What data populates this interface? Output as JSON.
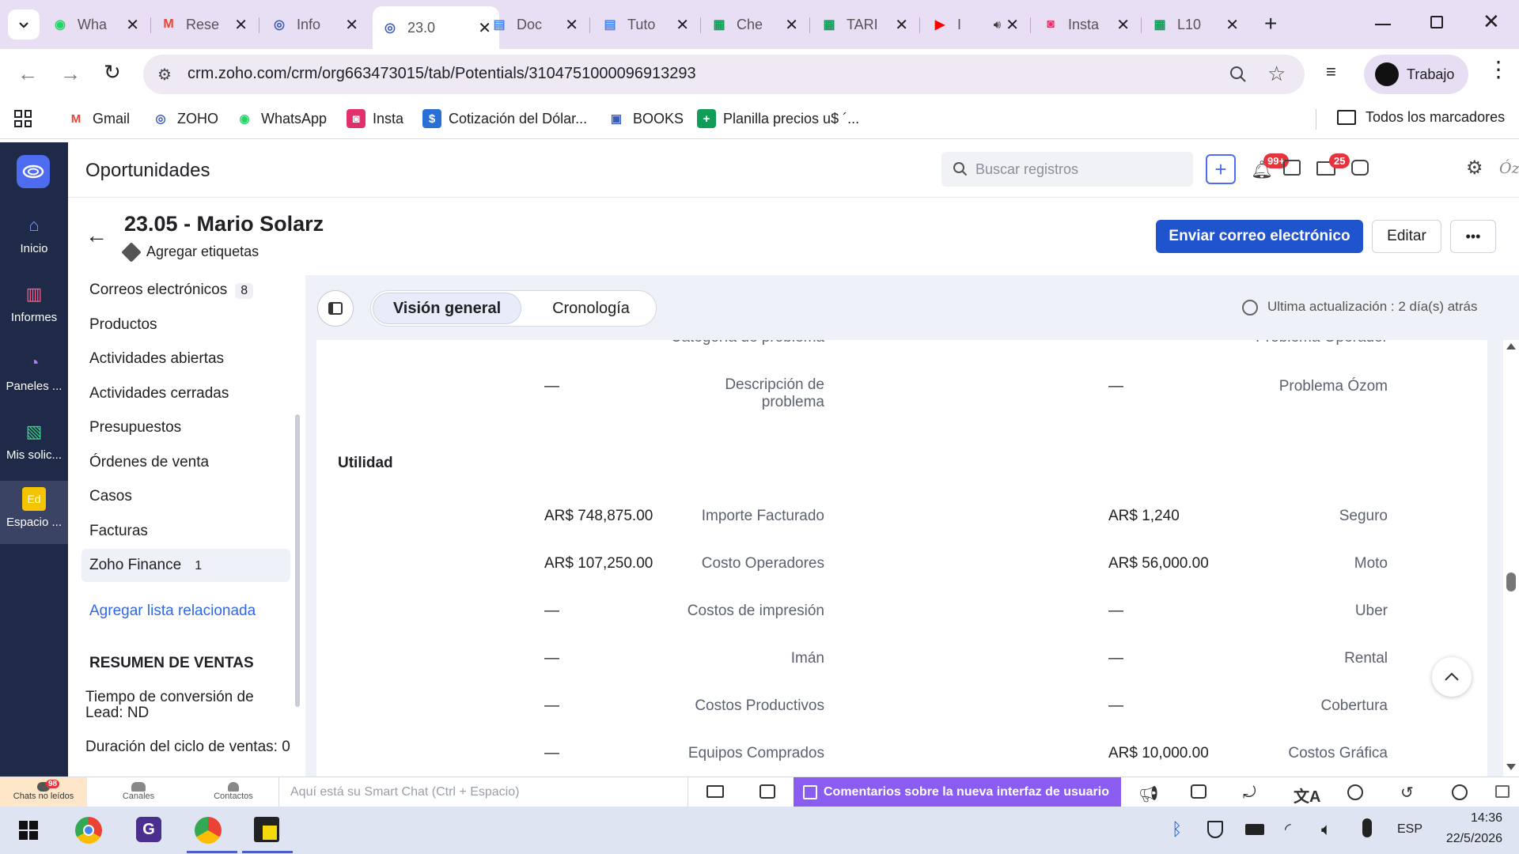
{
  "browser": {
    "tabs": [
      {
        "title": "Wha",
        "icon": "whatsapp-icon",
        "color": "#25d366"
      },
      {
        "title": "Rese",
        "icon": "gmail-icon",
        "color": "#ea4335"
      },
      {
        "title": "Info",
        "icon": "zoho-crm-icon",
        "color": "#3a5bb8"
      },
      {
        "title": "23.0",
        "icon": "zoho-crm-icon",
        "color": "#3a5bb8"
      },
      {
        "title": "Doc",
        "icon": "docs-icon",
        "color": "#4285f4"
      },
      {
        "title": "Tuto",
        "icon": "docs-icon",
        "color": "#4285f4"
      },
      {
        "title": "Che",
        "icon": "sheets-icon",
        "color": "#0f9d58"
      },
      {
        "title": "TARI",
        "icon": "sheets-icon",
        "color": "#0f9d58"
      },
      {
        "title": "I",
        "icon": "youtube-icon",
        "color": "#ff0000"
      },
      {
        "title": "Insta",
        "icon": "instagram-icon",
        "color": "#e1306c"
      },
      {
        "title": "L10",
        "icon": "sheets-icon",
        "color": "#0f9d58"
      }
    ],
    "url": "crm.zoho.com/crm/org663473015/tab/Potentials/3104751000096913293",
    "profile_label": "Trabajo",
    "bookmarks": [
      {
        "label": "Gmail",
        "icon": "gmail-icon"
      },
      {
        "label": "ZOHO",
        "icon": "zoho-crm-icon"
      },
      {
        "label": "WhatsApp",
        "icon": "whatsapp-icon"
      },
      {
        "label": "Insta",
        "icon": "instagram-icon"
      },
      {
        "label": "Cotización del Dólar...",
        "icon": "dollar-icon"
      },
      {
        "label": "BOOKS",
        "icon": "books-icon"
      },
      {
        "label": "Planilla precios u$ ´...",
        "icon": "sheets-icon"
      }
    ],
    "all_bookmarks": "Todos los marcadores"
  },
  "zoho": {
    "nav": [
      {
        "label": "Inicio",
        "icon": "home-icon"
      },
      {
        "label": "Informes",
        "icon": "reports-icon"
      },
      {
        "label": "Paneles ...",
        "icon": "dashboard-icon"
      },
      {
        "label": "Mis solic...",
        "icon": "requests-icon"
      },
      {
        "label": "Espacio ...",
        "icon": "workspace-icon",
        "badge": "Ed"
      }
    ],
    "module_title": "Oportunidades",
    "search_placeholder": "Buscar registros",
    "notif_count": "99+",
    "mail_count": "25",
    "brand_mark": "Ózom",
    "record": {
      "title": "23.05 - Mario Solarz",
      "add_tags": "Agregar etiquetas",
      "send_email": "Enviar correo electrónico",
      "edit": "Editar",
      "more": "•••"
    },
    "related": [
      {
        "label": "Correos electrónicos",
        "count": "8"
      },
      {
        "label": "Productos"
      },
      {
        "label": "Actividades abiertas"
      },
      {
        "label": "Actividades cerradas"
      },
      {
        "label": "Presupuestos"
      },
      {
        "label": "Órdenes de venta"
      },
      {
        "label": "Casos"
      },
      {
        "label": "Facturas"
      },
      {
        "label": "Zoho Finance",
        "count": "1"
      }
    ],
    "add_related": "Agregar lista relacionada",
    "sales_summary": {
      "title": "RESUMEN DE VENTAS",
      "lead_conversion": "Tiempo de conversión de Lead: ND",
      "cycle_duration": "Duración del ciclo de ventas: 0"
    },
    "view_tabs": {
      "overview": "Visión general",
      "timeline": "Cronología"
    },
    "last_update": "Ultima actualización : 2 día(s) atrás",
    "fields_top": [
      {
        "label": "Categoría de problema",
        "value": "—"
      },
      {
        "label": "Problema Operador",
        "value": "—"
      }
    ],
    "desc_row": [
      {
        "label": "Descripción de problema",
        "value": "—"
      },
      {
        "label": "Problema Ózom",
        "value": "—"
      }
    ],
    "section_title": "Utilidad",
    "fields": [
      {
        "left": {
          "label": "Importe Facturado",
          "value": "AR$ 748,875.00"
        },
        "right": {
          "label": "Seguro",
          "value": "AR$ 1,240"
        }
      },
      {
        "left": {
          "label": "Costo Operadores",
          "value": "AR$ 107,250.00"
        },
        "right": {
          "label": "Moto",
          "value": "AR$ 56,000.00"
        }
      },
      {
        "left": {
          "label": "Costos de impresión",
          "value": "—"
        },
        "right": {
          "label": "Uber",
          "value": "—"
        }
      },
      {
        "left": {
          "label": "Imán",
          "value": "—"
        },
        "right": {
          "label": "Rental",
          "value": "—"
        }
      },
      {
        "left": {
          "label": "Costos Productivos",
          "value": "—"
        },
        "right": {
          "label": "Cobertura",
          "value": "—"
        }
      },
      {
        "left": {
          "label": "Equipos Comprados",
          "value": "—"
        },
        "right": {
          "label": "Costos Gráfica",
          "value": "AR$ 10,000.00"
        }
      }
    ],
    "bottom": {
      "chats_label": "Chats no leídos",
      "chats_count": "98",
      "channels": "Canales",
      "contacts": "Contactos",
      "smart_chat": "Aquí está su Smart Chat (Ctrl + Espacio)",
      "feedback": "Comentarios sobre la nueva interfaz de usuario"
    }
  },
  "taskbar": {
    "lang": "ESP",
    "time": "14:36",
    "date": "22/5/2026"
  }
}
